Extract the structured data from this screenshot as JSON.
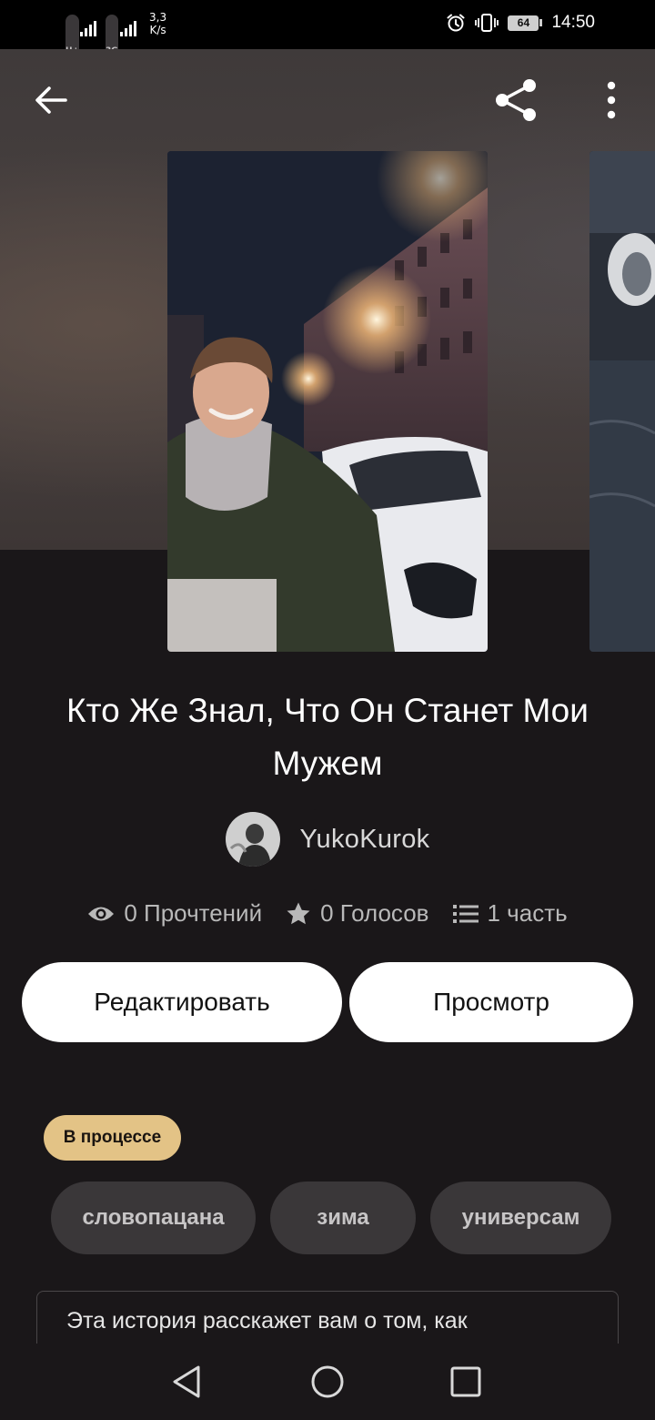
{
  "status_bar": {
    "network_1": "H+",
    "network_2": "3G",
    "speed_value": "3,3",
    "speed_unit": "K/s",
    "battery": "64",
    "time": "14:50",
    "icons": [
      "alarm-icon",
      "vibrate-icon"
    ]
  },
  "header": {
    "icons": [
      "arrow-left-icon",
      "share-icon",
      "more-vertical-icon"
    ]
  },
  "story": {
    "title": "Кто Же Знал, Что Он Станет Мои Мужем",
    "author": "YukoKurok",
    "reads": "0 Прочтений",
    "votes": "0 Голосов",
    "parts": "1 часть",
    "status": "В процессе",
    "tags": [
      "словопацана",
      "зима",
      "универсам"
    ],
    "description": "Эта история расскажет вам о том, как"
  },
  "actions": {
    "edit_label": "Редактировать",
    "view_label": "Просмотр"
  },
  "colors": {
    "background": "#1a1719",
    "status_pill": "#e3c386",
    "tag_bg": "#3a3739",
    "button_bg": "#ffffff"
  }
}
